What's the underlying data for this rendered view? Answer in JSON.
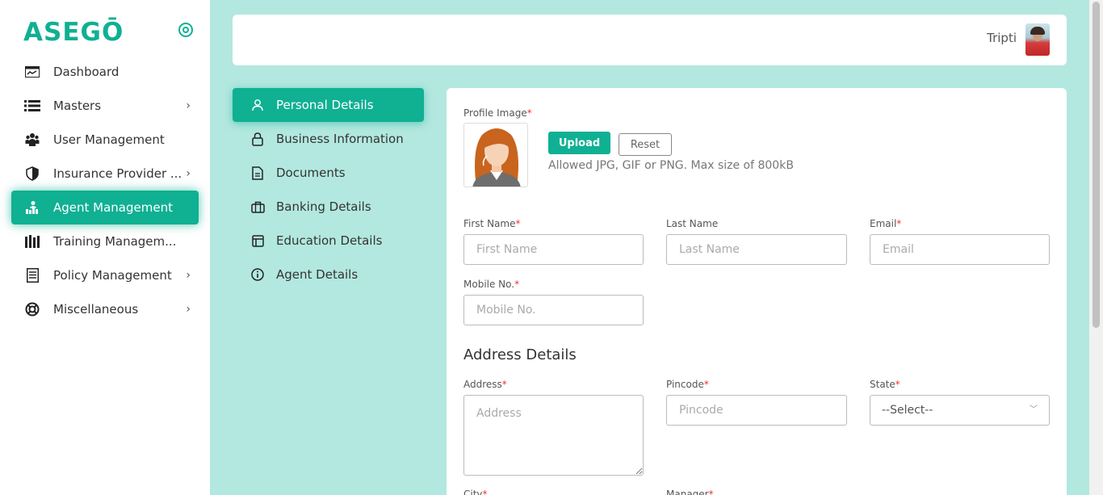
{
  "brand": {
    "logo": "ASEGŌ"
  },
  "sidebar": {
    "items": [
      {
        "label": "Dashboard",
        "icon": "dashboard-icon"
      },
      {
        "label": "Masters",
        "icon": "list-icon",
        "has_submenu": true
      },
      {
        "label": "User Management",
        "icon": "users-icon"
      },
      {
        "label": "Insurance Provider ...",
        "icon": "shield-icon",
        "has_submenu": true
      },
      {
        "label": "Agent Management",
        "icon": "agent-icon",
        "active": true
      },
      {
        "label": "Training Managem...",
        "icon": "books-icon"
      },
      {
        "label": "Policy Management",
        "icon": "document-icon",
        "has_submenu": true
      },
      {
        "label": "Miscellaneous",
        "icon": "lifebuoy-icon",
        "has_submenu": true
      }
    ]
  },
  "header": {
    "user_name": "Tripti"
  },
  "subtabs": [
    {
      "label": "Personal Details",
      "icon": "user-icon",
      "active": true
    },
    {
      "label": "Business Information",
      "icon": "lock-icon"
    },
    {
      "label": "Documents",
      "icon": "file-icon"
    },
    {
      "label": "Banking Details",
      "icon": "briefcase-icon"
    },
    {
      "label": "Education Details",
      "icon": "layout-icon"
    },
    {
      "label": "Agent Details",
      "icon": "info-icon"
    }
  ],
  "form": {
    "profile_image_label": "Profile Image",
    "upload_label": "Upload",
    "reset_label": "Reset",
    "upload_hint": "Allowed JPG, GIF or PNG. Max size of 800kB",
    "first_name_label": "First Name",
    "first_name_placeholder": "First Name",
    "last_name_label": "Last Name",
    "last_name_placeholder": "Last Name",
    "email_label": "Email",
    "email_placeholder": "Email",
    "mobile_label": "Mobile No.",
    "mobile_placeholder": "Mobile No.",
    "address_section_title": "Address Details",
    "address_label": "Address",
    "address_placeholder": "Address",
    "pincode_label": "Pincode",
    "pincode_placeholder": "Pincode",
    "state_label": "State",
    "state_value": "--Select--",
    "city_label": "City",
    "manager_label": "Manager",
    "required_mark": "*"
  },
  "colors": {
    "accent": "#10b093",
    "background": "#b2e8df",
    "required": "#ee3333"
  }
}
